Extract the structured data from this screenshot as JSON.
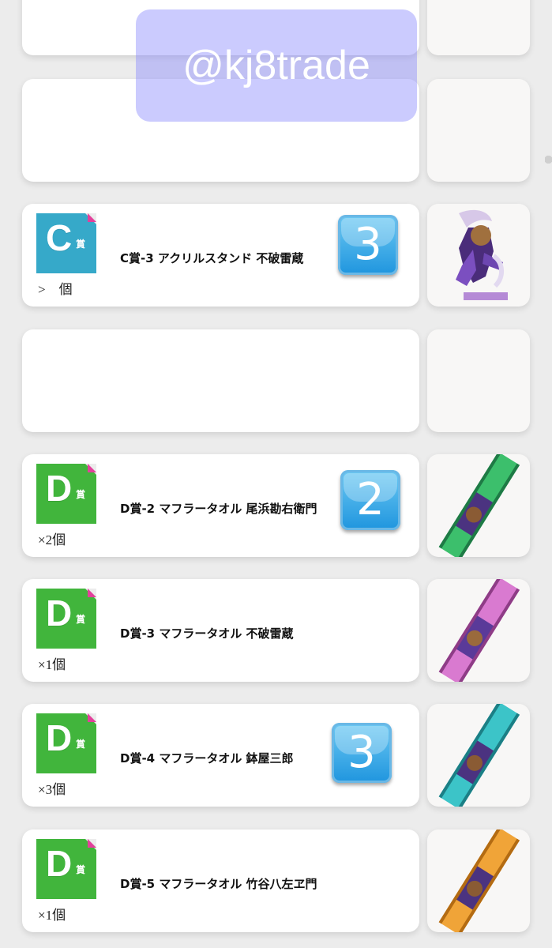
{
  "watermark": "@kj8trade",
  "items": [
    {
      "badge": "C",
      "badge_suffix": "賞",
      "badge_color": "#36a9c9",
      "qty": ">　個",
      "name": "C賞-3 アクリルスタンド 不破雷蔵",
      "key": "3",
      "thumb": "acrylic-stand-image"
    },
    {
      "badge": "D",
      "badge_suffix": "賞",
      "badge_color": "#41b53c",
      "qty": "×2個",
      "name": "D賞-2 マフラータオル 尾浜勘右衛門",
      "key": "2",
      "thumb": "towel-green-image"
    },
    {
      "badge": "D",
      "badge_suffix": "賞",
      "badge_color": "#41b53c",
      "qty": "×1個",
      "name": "D賞-3 マフラータオル 不破雷蔵",
      "key": "",
      "thumb": "towel-pink-image"
    },
    {
      "badge": "D",
      "badge_suffix": "賞",
      "badge_color": "#41b53c",
      "qty": "×3個",
      "name": "D賞-4 マフラータオル 鉢屋三郎",
      "key": "3",
      "thumb": "towel-teal-image"
    },
    {
      "badge": "D",
      "badge_suffix": "賞",
      "badge_color": "#41b53c",
      "qty": "×1個",
      "name": "D賞-5 マフラータオル 竹谷八左ヱ門",
      "key": "",
      "thumb": "towel-orange-image"
    }
  ]
}
